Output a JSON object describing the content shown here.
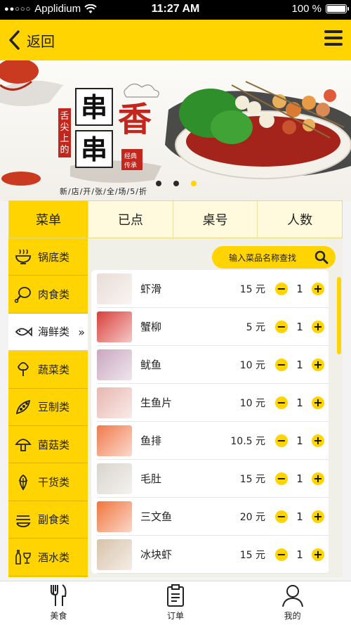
{
  "status_bar": {
    "carrier": "Applidium",
    "time": "11:27 AM",
    "battery": "100 %",
    "battery_level": 1.0
  },
  "header": {
    "back_label": "返回",
    "menu_icon": "hamburger-menu-icon",
    "back_icon": "chevron-left-icon"
  },
  "banner": {
    "title_chars": [
      "串",
      "串",
      "香"
    ],
    "side_text": "舌尖上的",
    "seal_text": "经典传承",
    "subtitle": "新/店/开/张/全/场/5/折",
    "dots": [
      false,
      false,
      true
    ]
  },
  "tabs": [
    {
      "label": "菜单",
      "active": true
    },
    {
      "label": "已点",
      "active": false
    },
    {
      "label": "桌号",
      "active": false
    },
    {
      "label": "人数",
      "active": false
    }
  ],
  "categories": [
    {
      "label": "锅底类",
      "icon": "hotpot-icon",
      "active": false
    },
    {
      "label": "肉食类",
      "icon": "drumstick-icon",
      "active": false
    },
    {
      "label": "海鲜类",
      "icon": "fish-icon",
      "active": true
    },
    {
      "label": "蔬菜类",
      "icon": "vegetable-icon",
      "active": false
    },
    {
      "label": "豆制类",
      "icon": "beans-icon",
      "active": false
    },
    {
      "label": "菌菇类",
      "icon": "mushroom-icon",
      "active": false
    },
    {
      "label": "干货类",
      "icon": "dried-goods-icon",
      "active": false
    },
    {
      "label": "副食类",
      "icon": "bowls-icon",
      "active": false
    },
    {
      "label": "酒水类",
      "icon": "drinks-icon",
      "active": false
    }
  ],
  "search": {
    "placeholder": "输入菜品名称查找"
  },
  "items": [
    {
      "name": "虾滑",
      "price": "15 元",
      "qty": "1",
      "color": "#e9dcd6"
    },
    {
      "name": "蟹柳",
      "price": "5 元",
      "qty": "1",
      "color": "#d8403a"
    },
    {
      "name": "鱿鱼",
      "price": "10 元",
      "qty": "1",
      "color": "#c9a7bf"
    },
    {
      "name": "生鱼片",
      "price": "10 元",
      "qty": "1",
      "color": "#e8b7b0"
    },
    {
      "name": "鱼排",
      "price": "10.5 元",
      "qty": "1",
      "color": "#f07a4c"
    },
    {
      "name": "毛肚",
      "price": "15 元",
      "qty": "1",
      "color": "#d9d4cc"
    },
    {
      "name": "三文鱼",
      "price": "20 元",
      "qty": "1",
      "color": "#f0753e"
    },
    {
      "name": "冰块虾",
      "price": "15 元",
      "qty": "1",
      "color": "#d8c2aa"
    }
  ],
  "stepper": {
    "minus": "−",
    "plus": "+"
  },
  "bottom_nav": [
    {
      "label": "美食",
      "icon": "fork-knife-icon"
    },
    {
      "label": "订单",
      "icon": "clipboard-icon"
    },
    {
      "label": "我的",
      "icon": "user-icon"
    }
  ],
  "colors": {
    "accent": "#ffd400",
    "text": "#222222"
  }
}
